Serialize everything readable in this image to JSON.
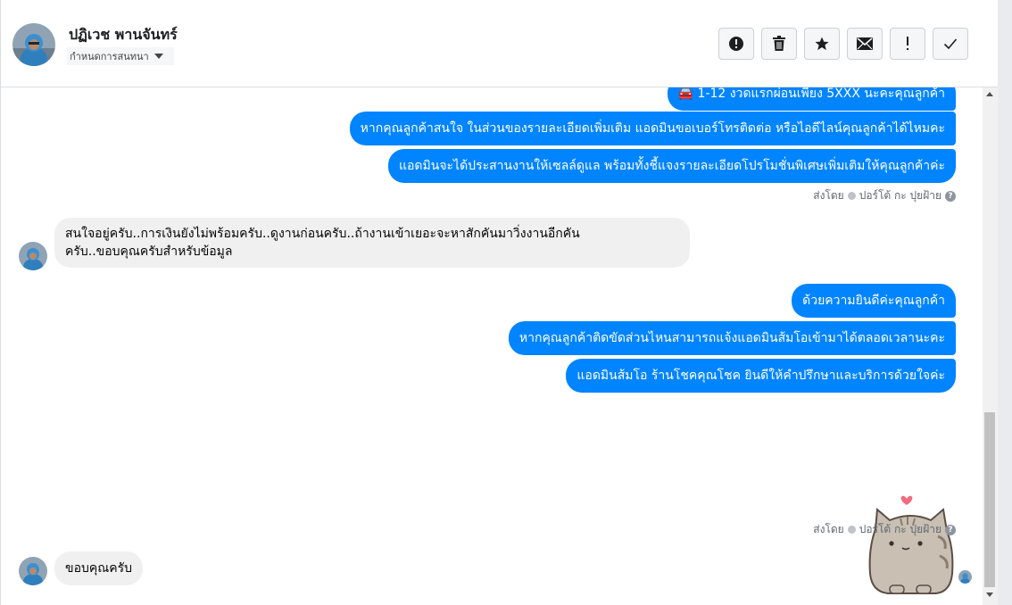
{
  "header": {
    "contact_name": "ปฏิเวช พานจันทร์",
    "assign_label": "กำหนดการสนทนา",
    "actions": [
      {
        "name": "spam-button",
        "icon": "alert-circle-icon"
      },
      {
        "name": "delete-button",
        "icon": "trash-icon"
      },
      {
        "name": "star-button",
        "icon": "star-icon"
      },
      {
        "name": "mark-unread-button",
        "icon": "envelope-icon"
      },
      {
        "name": "follow-up-button",
        "icon": "exclamation-icon"
      },
      {
        "name": "mark-done-button",
        "icon": "checkmark-icon"
      }
    ]
  },
  "messages": {
    "out_group1": [
      "🚘 1-12 งวดแรกผ่อนเพียง 5XXX นะคะคุณลูกค้า",
      "หากคุณลูกค้าสนใจ ในส่วนของรายละเอียดเพิ่มเติม แอดมินขอเบอร์โทรติดต่อ หรือไอดีไลน์คุณลูกค้าได้ไหมคะ",
      "แอดมินจะได้ประสานงานให้เซลล์ดูแล พร้อมทั้งชี้แจงรายละเอียดโปรโมชั่นพิเศษเพิ่มเติมให้คุณลูกค้าค่ะ"
    ],
    "sent_by": "ส่งโดย",
    "sender_name": "ปอร์โต้ กะ ปุยฝ้าย",
    "help_glyph": "?",
    "in1_line1": "สนใจอยู่ครับ..การเงินยังไม่พร้อมครับ..ดูงานก่อนครับ..ถ้างานเข้าเยอะจะหาสักคันมาวิ่งงานอีกคัน",
    "in1_line2": "ครับ..ขอบคุณครับสำหรับข้อมูล",
    "out_group2": [
      "ด้วยความยินดีค่ะคุณลูกค้า",
      "หากคุณลูกค้าติดขัดส่วนไหนสามารถแจ้งแอดมินส้มโอเข้ามาได้ตลอดเวลานะคะ",
      "แอดมินส้มโอ ร้านโชคคุณโชค ยินดีให้คำปรึกษาและบริการด้วยใจค่ะ"
    ],
    "in2": "ขอบคุณครับ"
  },
  "colors": {
    "outgoing_bubble": "#0084ff",
    "incoming_bubble": "#f0f0f0"
  }
}
